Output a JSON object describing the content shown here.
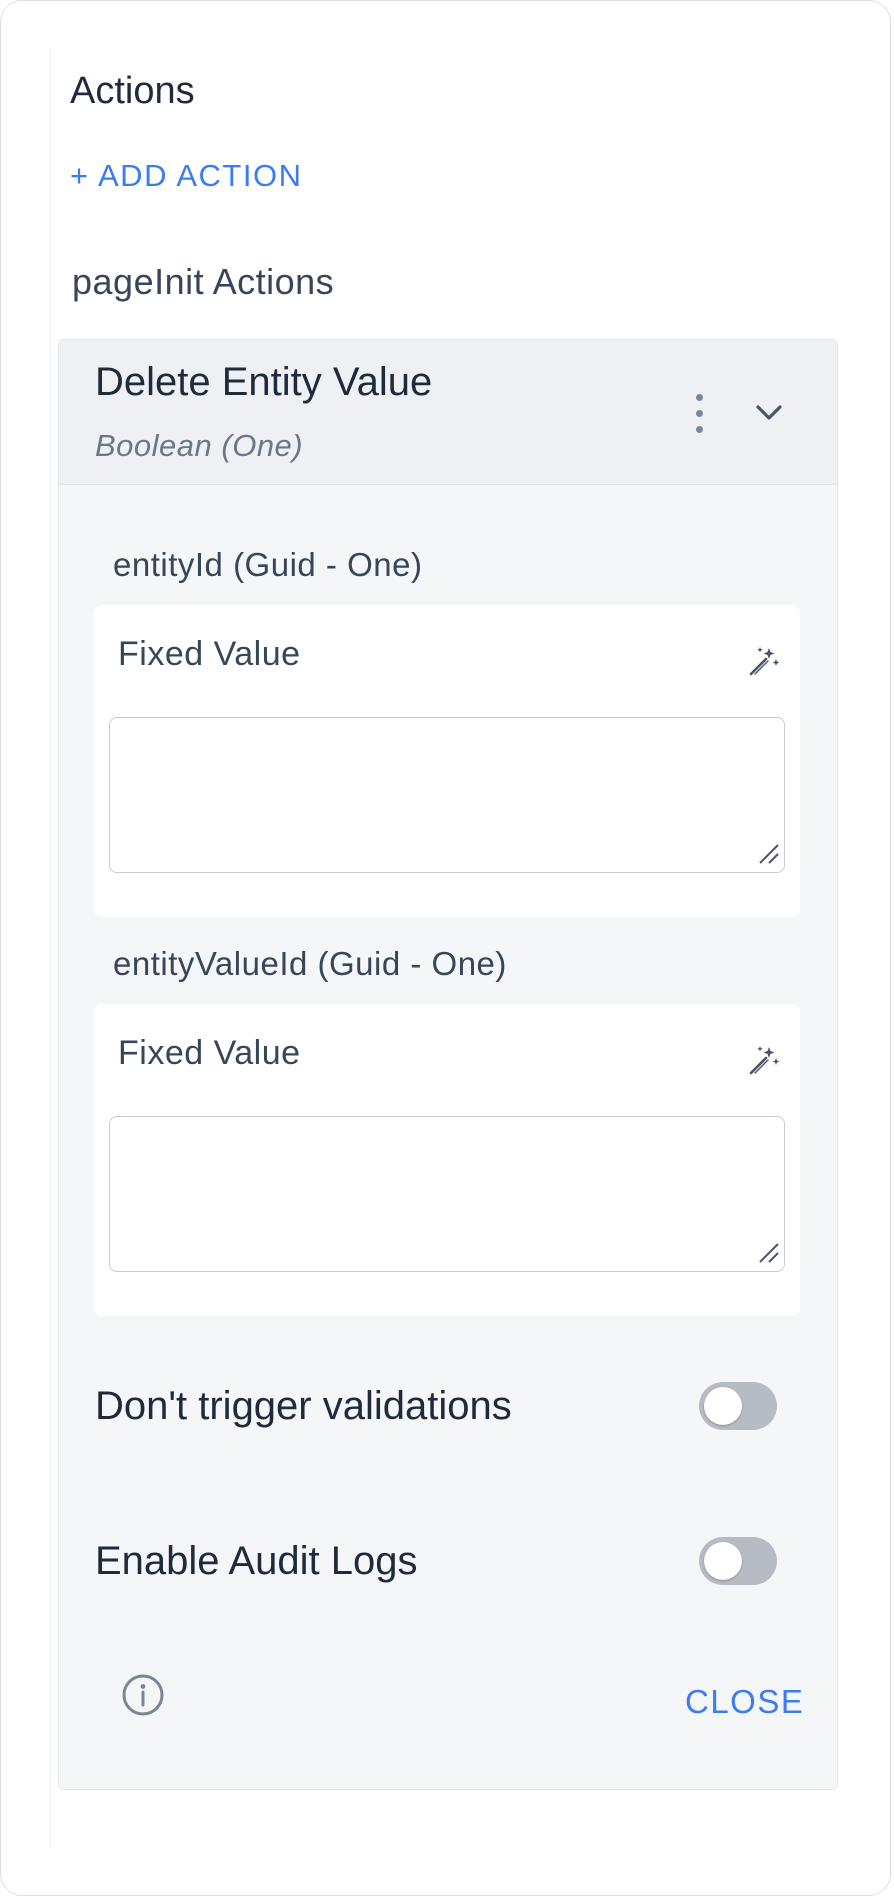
{
  "panel": {
    "title": "Actions",
    "add_action_label": "+ ADD ACTION",
    "group_title": "pageInit Actions"
  },
  "action_card": {
    "title": "Delete Entity Value",
    "subtitle": "Boolean (One)",
    "menu_icon": "kebab-menu-icon",
    "expand_icon": "chevron-down-icon",
    "params": [
      {
        "label": "entityId (Guid - One)",
        "source_label": "Fixed Value",
        "value": "",
        "icon": "magic-wand-icon"
      },
      {
        "label": "entityValueId (Guid - One)",
        "source_label": "Fixed Value",
        "value": "",
        "icon": "magic-wand-icon"
      }
    ],
    "toggles": [
      {
        "label": "Don't trigger validations",
        "enabled": false
      },
      {
        "label": "Enable Audit Logs",
        "enabled": false
      }
    ],
    "info_icon": "info-icon",
    "close_label": "CLOSE"
  },
  "colors": {
    "accent": "#3b7cf0",
    "card_bg": "#f5f6f8",
    "header_bg": "#eef0f3",
    "toggle_off": "#b7bcc4"
  }
}
